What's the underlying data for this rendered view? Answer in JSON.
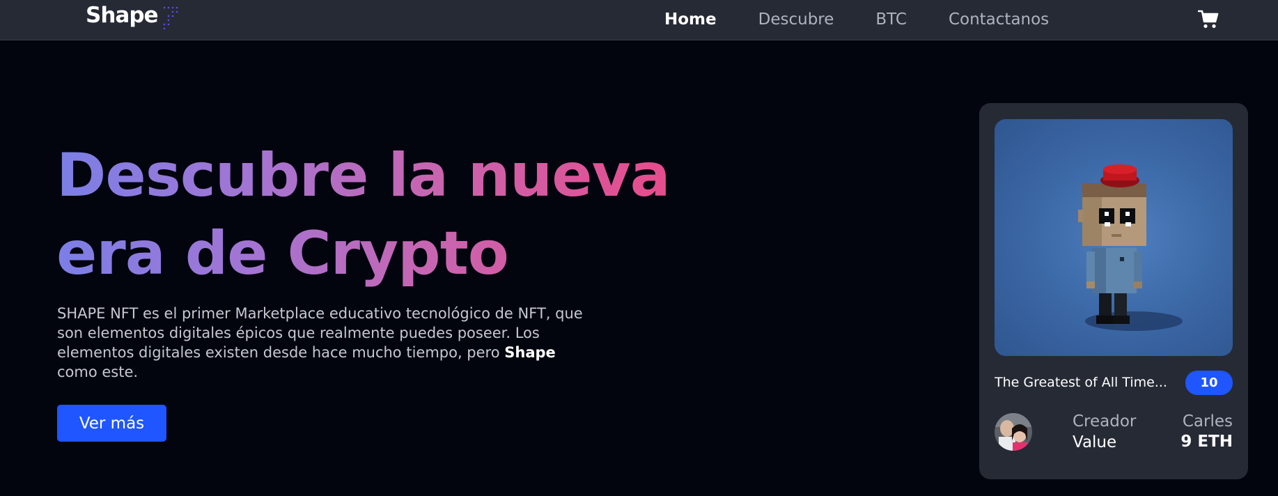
{
  "navbar": {
    "logo": "Shape",
    "links": [
      {
        "label": "Home",
        "active": true
      },
      {
        "label": "Descubre",
        "active": false
      },
      {
        "label": "BTC",
        "active": false
      },
      {
        "label": "Contactanos",
        "active": false
      }
    ],
    "cart_icon": "cart-icon"
  },
  "hero": {
    "title_line1": "Descubre la nueva",
    "title_line2": "era de Crypto",
    "desc_part1": "SHAPE NFT es el primer Marketplace educativo tecnológico de NFT, que son elementos digitales épicos que realmente puedes poseer. Los elementos digitales existen desde hace mucho tiempo, pero ",
    "desc_bold": "Shape",
    "desc_part2": " como este.",
    "cta_label": "Ver más"
  },
  "card": {
    "name": "The Greatest of All Time...",
    "badge": "10",
    "creator_label": "Creador",
    "creator_value": "Value",
    "owner_name": "Carles",
    "price": "9 ETH"
  },
  "colors": {
    "accent": "#1f56ff",
    "navbar_bg": "#262a35",
    "page_bg": "#03050e",
    "card_bg": "#262a35",
    "gradient_start": "#7b7fe6",
    "gradient_end": "#e84b8a"
  }
}
